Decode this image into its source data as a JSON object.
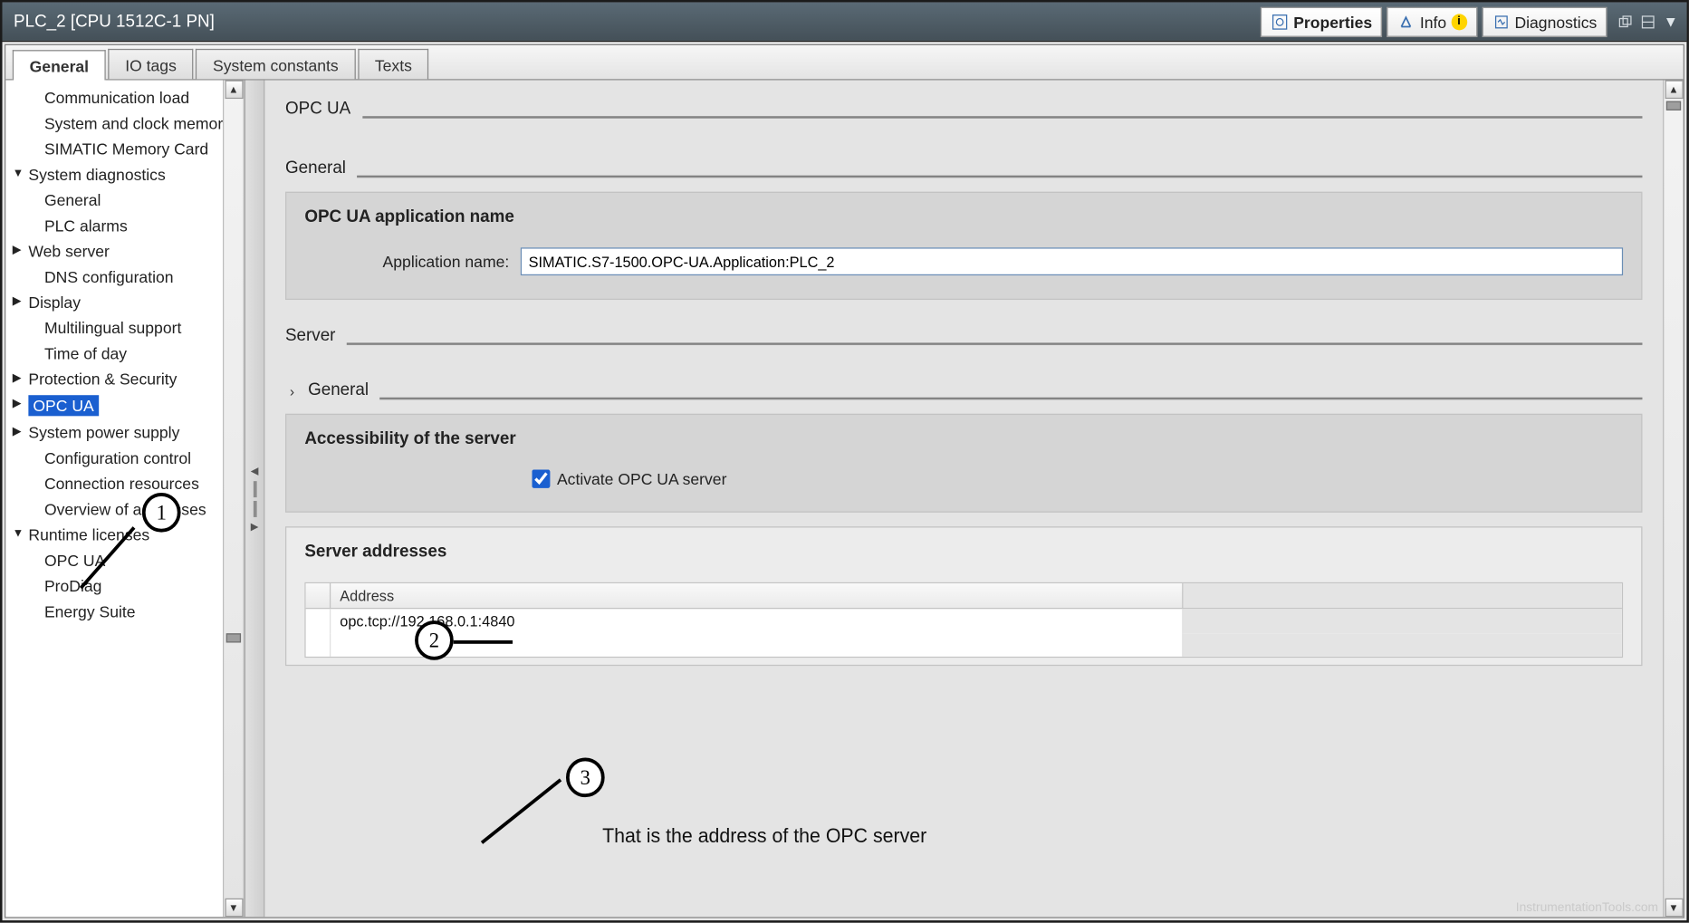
{
  "window": {
    "title": "PLC_2 [CPU 1512C-1 PN]",
    "tabs": {
      "properties": "Properties",
      "info": "Info",
      "diagnostics": "Diagnostics"
    }
  },
  "prop_tabs": {
    "general": "General",
    "io_tags": "IO tags",
    "system_constants": "System constants",
    "texts": "Texts"
  },
  "tree": {
    "items": [
      {
        "label": "Communication load",
        "indent": 1
      },
      {
        "label": "System and clock memory",
        "indent": 1
      },
      {
        "label": "SIMATIC Memory Card",
        "indent": 1
      },
      {
        "label": "System diagnostics",
        "indent": 0,
        "caret": "down"
      },
      {
        "label": "General",
        "indent": 1
      },
      {
        "label": "PLC alarms",
        "indent": 1
      },
      {
        "label": "Web server",
        "indent": 0,
        "caret": "right"
      },
      {
        "label": "DNS configuration",
        "indent": 1
      },
      {
        "label": "Display",
        "indent": 0,
        "caret": "right"
      },
      {
        "label": "Multilingual support",
        "indent": 1
      },
      {
        "label": "Time of day",
        "indent": 1
      },
      {
        "label": "Protection & Security",
        "indent": 0,
        "caret": "right"
      },
      {
        "label": "OPC UA",
        "indent": 0,
        "caret": "right",
        "selected": true
      },
      {
        "label": "System power supply",
        "indent": 0,
        "caret": "right"
      },
      {
        "label": "Configuration control",
        "indent": 1
      },
      {
        "label": "Connection resources",
        "indent": 1
      },
      {
        "label": "Overview of addresses",
        "indent": 1
      },
      {
        "label": "Runtime licenses",
        "indent": 0,
        "caret": "down"
      },
      {
        "label": "OPC UA",
        "indent": 1
      },
      {
        "label": "ProDiag",
        "indent": 1
      },
      {
        "label": "Energy Suite",
        "indent": 1
      }
    ]
  },
  "content": {
    "h_opcua": "OPC UA",
    "h_general": "General",
    "h_app_name": "OPC UA application name",
    "app_name_label": "Application name:",
    "app_name_value": "SIMATIC.S7-1500.OPC-UA.Application:PLC_2",
    "h_server": "Server",
    "h_sub_general": "General",
    "h_accessibility": "Accessibility of the server",
    "activate_label": "Activate OPC UA server",
    "activate_checked": true,
    "h_server_addresses": "Server addresses",
    "addr_col": "Address",
    "addr_rows": [
      "opc.tcp://192.168.0.1:4840"
    ]
  },
  "annotations": {
    "n1": "1",
    "n2": "2",
    "n3": "3",
    "text3": "That is the address of the OPC server"
  },
  "watermark": "InstrumentationTools.com"
}
